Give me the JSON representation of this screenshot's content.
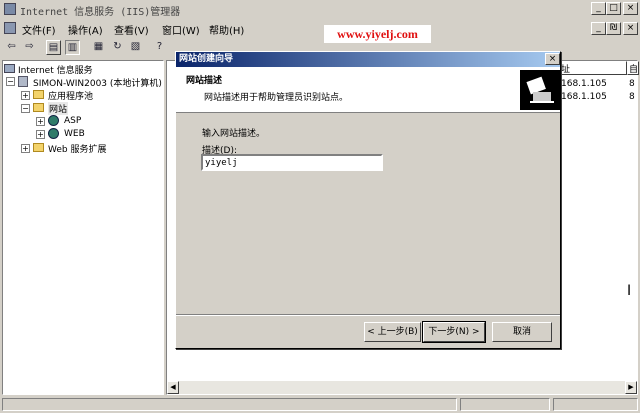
{
  "window": {
    "title": "Internet 信息服务 (IIS)管理器",
    "min": "_",
    "max": "□",
    "close": "×"
  },
  "menu": [
    "文件(F)",
    "操作(A)",
    "查看(V)",
    "窗口(W)",
    "帮助(H)"
  ],
  "child_controls": {
    "min": "_",
    "restore": "₪",
    "close": "×"
  },
  "watermark": "www.yiyelj.com",
  "tree": {
    "root": "Internet 信息服务",
    "server": "SIMON-WIN2003 (本地计算机)",
    "app_pools": "应用程序池",
    "websites": "网站",
    "site1": "ASP",
    "site2": "WEB",
    "ext": "Web 服务扩展"
  },
  "list": {
    "col1": "址",
    "col2": "自",
    "rows": [
      {
        "ip": "168.1.105",
        "v": "8"
      },
      {
        "ip": "168.1.105",
        "v": "8"
      }
    ]
  },
  "dialog": {
    "title": "网站创建向导",
    "heading": "网站描述",
    "subheading": "网站描述用于帮助管理员识别站点。",
    "prompt": "输入网站描述。",
    "field_label": "描述(D):",
    "field_value": "yiyelj",
    "back": "< 上一步(B)",
    "next": "下一步(N) >",
    "cancel": "取消",
    "close": "×"
  }
}
